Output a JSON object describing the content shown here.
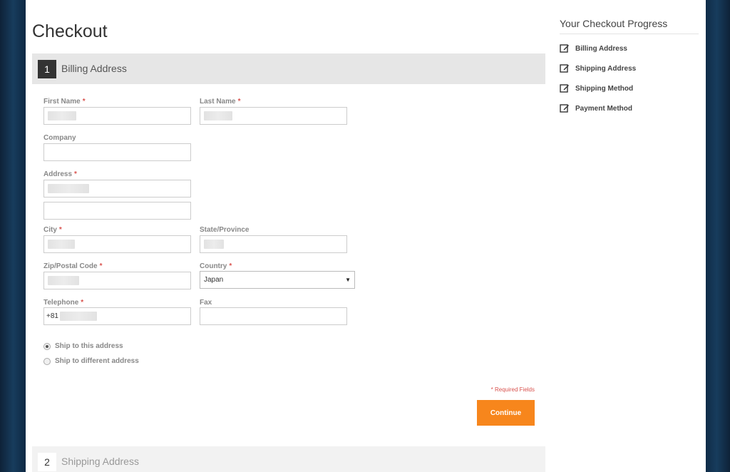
{
  "page": {
    "title": "Checkout"
  },
  "steps": [
    {
      "number": "1",
      "title": "Billing Address"
    },
    {
      "number": "2",
      "title": "Shipping Address"
    }
  ],
  "form": {
    "first_name": {
      "label": "First Name",
      "required": "*"
    },
    "last_name": {
      "label": "Last Name",
      "required": "*"
    },
    "company": {
      "label": "Company"
    },
    "address": {
      "label": "Address",
      "required": "*"
    },
    "city": {
      "label": "City",
      "required": "*"
    },
    "state": {
      "label": "State/Province"
    },
    "zip": {
      "label": "Zip/Postal Code",
      "required": "*"
    },
    "country": {
      "label": "Country",
      "required": "*",
      "value": "Japan"
    },
    "telephone": {
      "label": "Telephone",
      "required": "*",
      "value_prefix": "+81"
    },
    "fax": {
      "label": "Fax"
    }
  },
  "shipping_options": [
    {
      "label": "Ship to this address",
      "selected": true
    },
    {
      "label": "Ship to different address",
      "selected": false
    }
  ],
  "required_note": "* Required Fields",
  "continue_label": "Continue",
  "sidebar": {
    "title": "Your Checkout Progress",
    "items": [
      {
        "label": "Billing Address",
        "icon": "edit-icon"
      },
      {
        "label": "Shipping Address",
        "icon": "edit-icon"
      },
      {
        "label": "Shipping Method",
        "icon": "edit-icon"
      },
      {
        "label": "Payment Method",
        "icon": "edit-icon"
      }
    ]
  },
  "colors": {
    "accent": "#f7861c",
    "required": "#d9534f",
    "step_header": "#e6e6e6"
  }
}
